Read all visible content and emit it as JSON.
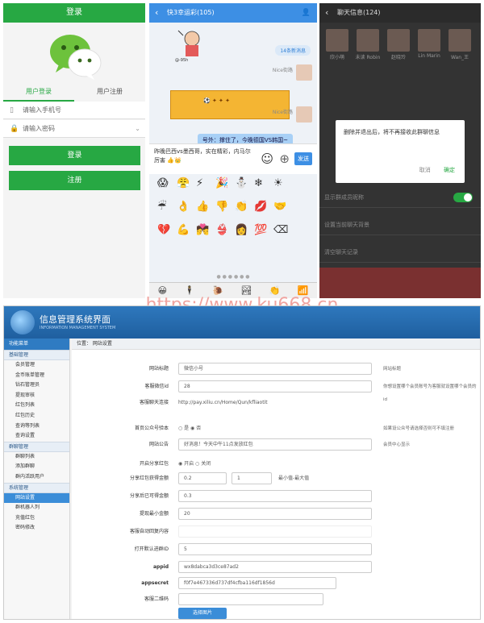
{
  "login": {
    "title": "登录",
    "tab_login": "用户登录",
    "tab_register": "用户注册",
    "phone_placeholder": "请输入手机号",
    "password_placeholder": "请输入密码",
    "login_button": "登录",
    "register_button": "注册"
  },
  "chat": {
    "title": "快3幸运彩(105)",
    "tip": "14条新消息",
    "nick1": "Nice街路",
    "nick2": "Nice街路",
    "bubble": "号外：撑住了，今晚德国VS韩国~",
    "input_text": "昨晚巴西vs墨西哥，实在精彩，内马尔厉害 👍👑",
    "send": "发送",
    "emojis": [
      "😱",
      "😤",
      "⚡",
      "🎉",
      "⛄",
      "❄",
      "☀",
      "",
      "☔",
      "👌",
      "👍",
      "👎",
      "👏",
      "💋",
      "🤝",
      "",
      "💔",
      "💪",
      "💏",
      "👙",
      "👩",
      "💯",
      "⌫",
      ""
    ],
    "bottom_icons": [
      "😀",
      "🕴",
      "🐌",
      "🏞",
      "👏",
      "📶"
    ]
  },
  "group": {
    "title": "聊天信息(124)",
    "members": [
      "欣小萌",
      "未读 Robin",
      "赵晓玲",
      "Lin Marin",
      "Wan_王"
    ],
    "dialog_text": "删除并退出后，将不再接收此群聊信息",
    "cancel": "取消",
    "confirm": "确定",
    "opt_show_nick": "显示群成员昵称",
    "opt_set_bg": "设置当前聊天背景",
    "opt_clear": "清空聊天记录"
  },
  "watermark": "https://www.ku668.cn",
  "admin": {
    "title": "信息管理系统界面",
    "subtitle": "INFORMATION MANAGEMENT SYSTEM",
    "menu_header": "功能菜单",
    "breadcrumb": "位置：  网站设置",
    "sections": [
      {
        "label": "基础管理",
        "items": [
          "会员管理",
          "金币账单管理",
          "钻石管理员",
          "提现审核",
          "红包列表",
          "红包历史",
          "查询等列表",
          "查询设置"
        ]
      },
      {
        "label": "群聊管理",
        "items": [
          "群聊列表",
          "添加群聊",
          "群内活跃用户"
        ]
      },
      {
        "label": "系统管理",
        "items": [
          "网站设置",
          "群机器人列",
          "充值红包",
          "密码修改"
        ]
      }
    ],
    "active_item": "网站设置",
    "fields": [
      {
        "label": "网站标题",
        "value": "微信小号",
        "note": "网站标题"
      },
      {
        "label": "客服微信id",
        "value": "28",
        "note": "你想设置哪个会员账号为客服就设置哪个会员的id"
      },
      {
        "label": "客服聊天连接",
        "value": "http://pay.xiliu.cn/Home/Qun/kfliaotit",
        "note": ""
      },
      {
        "label": "首页公众号验本",
        "value": "○ 是   ◉ 否",
        "note": "如果设公众号请选择否则可不填注册"
      },
      {
        "label": "网站公告",
        "value": "好消息！今天中午11点发放红包",
        "note": "会员中心显示"
      },
      {
        "label": "开启分享红包",
        "value": "◉ 开启   ○ 关闭",
        "note": ""
      },
      {
        "label": "分享红包获得金额",
        "value": "0.2",
        "value2": "1",
        "note": "最小值-最大值"
      },
      {
        "label": "分享后已可得金额",
        "value": "0.3",
        "note": ""
      },
      {
        "label": "提现最小金额",
        "value": "20",
        "note": ""
      },
      {
        "label": "客服自动回复内容",
        "value": "",
        "note": ""
      },
      {
        "label": "打开默认进群ID",
        "value": "5",
        "note": ""
      },
      {
        "label": "appid",
        "value": "wx8dabca3d3ce87ad2",
        "note": ""
      },
      {
        "label": "appsecret",
        "value": "f0f7e467336d737df4cfba116df1856d",
        "note": ""
      },
      {
        "label": "客服二维码",
        "value": "",
        "note": ""
      }
    ],
    "choose_button": "选择图片"
  }
}
